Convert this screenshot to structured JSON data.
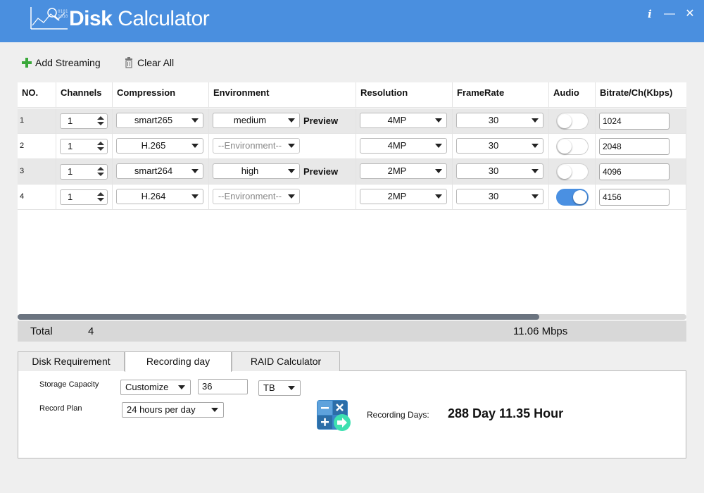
{
  "window": {
    "title_bold": "Disk",
    "title_rest": " Calculator",
    "info_glyph": "i",
    "minimize_glyph": "—",
    "close_glyph": "✕",
    "accent_color": "#4a8fdf"
  },
  "toolbar": {
    "add_label": "Add Streaming",
    "add_icon": "plus-icon",
    "clear_label": "Clear All",
    "clear_icon": "trash-icon"
  },
  "table": {
    "headers": {
      "no": "NO.",
      "channels": "Channels",
      "compression": "Compression",
      "environment": "Environment",
      "resolution": "Resolution",
      "framerate": "FrameRate",
      "audio": "Audio",
      "bitrate": "Bitrate/Ch(Kbps)"
    },
    "rows": [
      {
        "no": "1",
        "channels": "1",
        "compression": "smart265",
        "environment": "medium",
        "environment_enabled": true,
        "preview": "Preview",
        "resolution": "4MP",
        "framerate": "30",
        "audio_on": false,
        "bitrate": "1024"
      },
      {
        "no": "2",
        "channels": "1",
        "compression": "H.265",
        "environment": "--Environment--",
        "environment_enabled": false,
        "preview": "",
        "resolution": "4MP",
        "framerate": "30",
        "audio_on": false,
        "bitrate": "2048"
      },
      {
        "no": "3",
        "channels": "1",
        "compression": "smart264",
        "environment": "high",
        "environment_enabled": true,
        "preview": "Preview",
        "resolution": "2MP",
        "framerate": "30",
        "audio_on": false,
        "bitrate": "4096"
      },
      {
        "no": "4",
        "channels": "1",
        "compression": "H.264",
        "environment": "--Environment--",
        "environment_enabled": false,
        "preview": "",
        "resolution": "2MP",
        "framerate": "30",
        "audio_on": true,
        "bitrate": "4156"
      }
    ],
    "audio_on_color": "#4a90e2"
  },
  "scrollbar": {
    "position_fraction": 0.78
  },
  "totals": {
    "label": "Total",
    "count": "4",
    "bandwidth": "11.06 Mbps"
  },
  "tabs": [
    {
      "label": "Disk Requirement",
      "active": false
    },
    {
      "label": "Recording day",
      "active": true
    },
    {
      "label": "RAID Calculator",
      "active": false
    }
  ],
  "recording_day": {
    "storage_label": "Storage Capacity",
    "storage_mode": "Customize",
    "storage_value": "36",
    "storage_unit": "TB",
    "plan_label": "Record Plan",
    "plan_value": "24 hours per day",
    "calc_icon": "calculator-icon",
    "result_label": "Recording Days:",
    "result_value": "288  Day 11.35 Hour"
  }
}
